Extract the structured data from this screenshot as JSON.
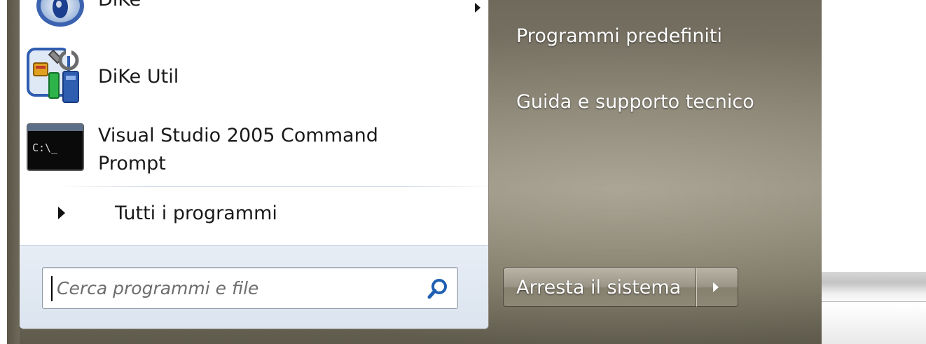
{
  "programs": [
    {
      "label": "DiKe",
      "icon": "dike-eye-icon",
      "has_submenu": true
    },
    {
      "label": "DiKe Util",
      "icon": "dike-util-tools-icon",
      "has_submenu": false
    },
    {
      "label_line1": "Visual Studio 2005 Command",
      "label_line2": "Prompt",
      "icon": "command-prompt-icon",
      "icon_text": "C:\\_"
    }
  ],
  "all_programs": {
    "label": "Tutti i programmi"
  },
  "search": {
    "placeholder": "Cerca programmi e file",
    "value": ""
  },
  "right_links": [
    {
      "label": "Programmi predefiniti"
    },
    {
      "label": "Guida e supporto tecnico"
    }
  ],
  "shutdown": {
    "label": "Arresta il sistema"
  },
  "colors": {
    "left_panel": "#ffffff",
    "left_bottom": "#dbe4ef",
    "glass": "#7b7565",
    "accent_blue": "#1e5fb3"
  }
}
